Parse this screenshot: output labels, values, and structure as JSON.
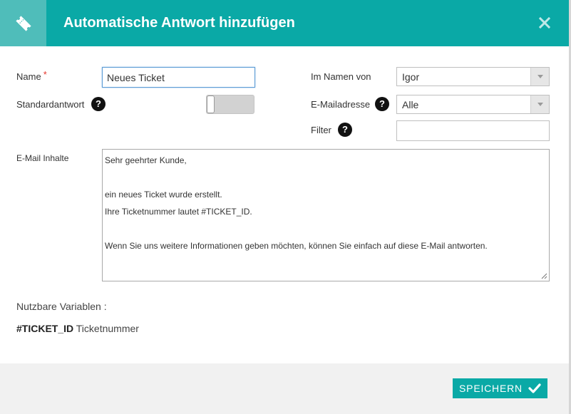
{
  "dialog": {
    "title": "Automatische Antwort hinzufügen",
    "close_label": "✕"
  },
  "form": {
    "name_label": "Name",
    "name_required_mark": "*",
    "name_value": "Neues Ticket",
    "standard_label": "Standardantwort",
    "standard_enabled": false,
    "on_behalf_label": "Im Namen von",
    "on_behalf_value": "Igor",
    "email_label": "E-Mailadresse",
    "email_value": "Alle",
    "filter_label": "Filter",
    "filter_value": "",
    "content_label": "E-Mail Inhalte",
    "help_glyph": "?",
    "content_lines": [
      "Sehr geehrter Kunde,",
      "",
      "ein neues Ticket wurde erstellt.",
      "Ihre Ticketnummer lautet #TICKET_ID.",
      "",
      "Wenn Sie uns weitere Informationen geben möchten, können Sie einfach auf diese E-Mail antworten."
    ]
  },
  "variables": {
    "title": "Nutzbare Variablen :",
    "items": [
      {
        "key": "#TICKET_ID",
        "desc": "Ticketnummer"
      }
    ]
  },
  "footer": {
    "save_label": "SPEICHERN"
  },
  "colors": {
    "accent": "#0aa9a6",
    "accent_light": "#4fbdba",
    "required": "#e5352b",
    "footer_bg": "#f1f1f1"
  },
  "icons": {
    "header": "ticket-icon",
    "close": "close-icon",
    "help": "question-circle-icon",
    "dropdown": "chevron-down-icon",
    "save": "check-icon"
  }
}
